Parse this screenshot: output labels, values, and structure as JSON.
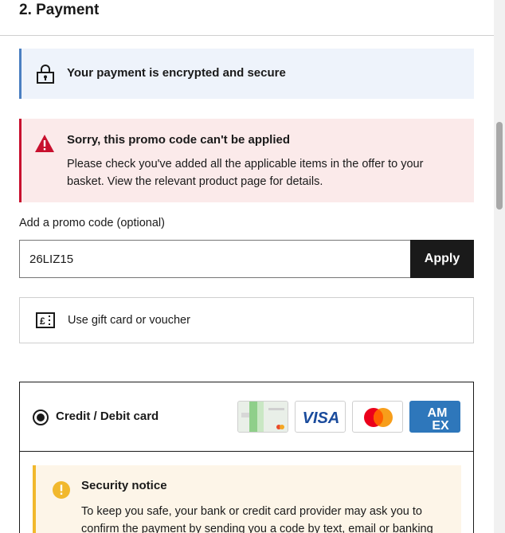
{
  "section": {
    "title": "2. Payment"
  },
  "secure_banner": {
    "text": "Your payment is encrypted and secure",
    "icon": "padlock-icon"
  },
  "error_banner": {
    "heading": "Sorry, this promo code can't be applied",
    "body": "Please check you've added all the applicable items in the offer to your basket. View the relevant product page for details.",
    "icon": "warning-triangle-icon",
    "accent": "#c8102e"
  },
  "promo": {
    "label": "Add a promo code (optional)",
    "value": "26LIZ15",
    "apply_label": "Apply"
  },
  "gift": {
    "label": "Use gift card or voucher",
    "icon": "gift-card-pound-icon"
  },
  "payment_method": {
    "label": "Credit / Debit card",
    "selected": true,
    "logos": [
      "generic-card-logo",
      "visa-logo",
      "mastercard-logo",
      "amex-logo"
    ],
    "amex_text": "AM EX"
  },
  "security_notice": {
    "heading": "Security notice",
    "body": "To keep you safe, your bank or credit card provider may ask you to confirm the payment by sending you a code by text, email or banking",
    "icon": "exclamation-circle-icon",
    "accent": "#f1b82d"
  },
  "colors": {
    "info_accent": "#4a7fc1",
    "button_bg": "#1a1a1a",
    "amex_blue": "#2e77bb"
  }
}
